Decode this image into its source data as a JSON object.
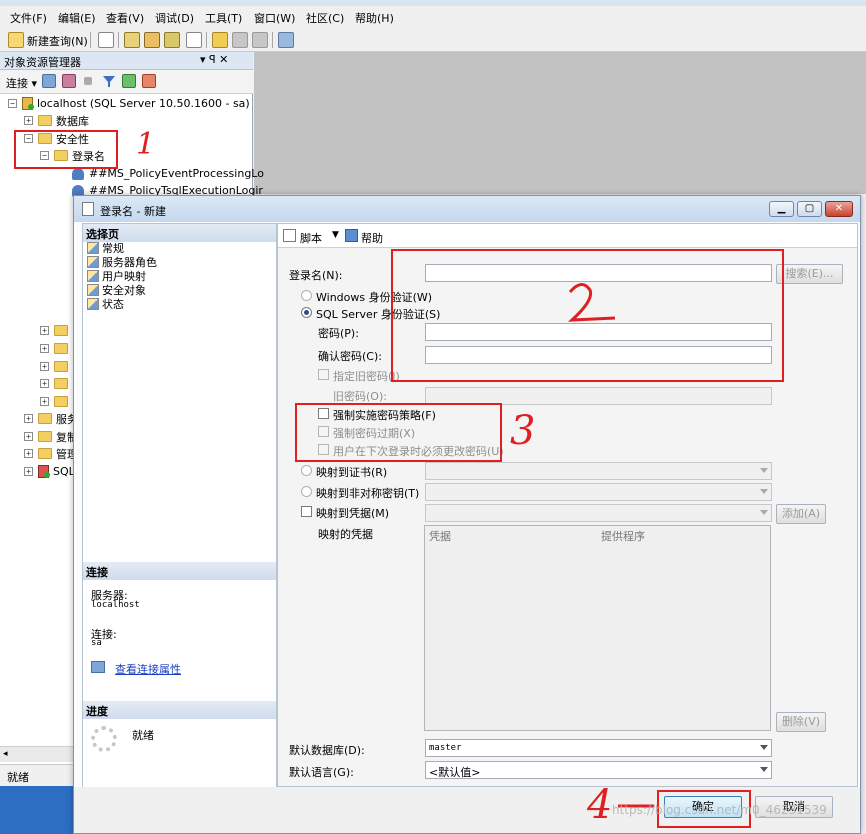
{
  "menubar": [
    "文件(F)",
    "编辑(E)",
    "查看(V)",
    "调试(D)",
    "工具(T)",
    "窗口(W)",
    "社区(C)",
    "帮助(H)"
  ],
  "toolbar": {
    "new_query": "新建查询(N)"
  },
  "object_explorer": {
    "title": "对象资源管理器",
    "pin": "▾ ꟼ ✕",
    "connect": "连接 ▾",
    "tree": {
      "server": "localhost (SQL Server 10.50.1600 - sa)",
      "databases": "数据库",
      "security": "安全性",
      "logins": "登录名",
      "login1": "##MS_PolicyEventProcessingLo",
      "login2": "##MS_PolicyTsqlExecutionLogir",
      "server_objects": "服务",
      "replication": "复制",
      "management": "管理",
      "sql_agent": "SQL"
    }
  },
  "statusbar": {
    "text": "就绪"
  },
  "dialog": {
    "title": "登录名 - 新建",
    "select_page": {
      "header": "选择页",
      "items": [
        "常规",
        "服务器角色",
        "用户映射",
        "安全对象",
        "状态"
      ]
    },
    "connection": {
      "header": "连接",
      "server_label": "服务器:",
      "server_value": "localhost",
      "conn_label": "连接:",
      "conn_value": "sa",
      "view_props": "查看连接属性"
    },
    "progress": {
      "header": "进度",
      "status": "就绪"
    },
    "toolbar": {
      "script": "脚本",
      "help": "帮助"
    },
    "form": {
      "login_name_label": "登录名(N):",
      "search_button": "搜索(E)...",
      "windows_auth": "Windows 身份验证(W)",
      "sql_auth": "SQL Server 身份验证(S)",
      "password_label": "密码(P):",
      "confirm_password_label": "确认密码(C):",
      "specify_old_password": "指定旧密码(I)",
      "old_password_label": "旧密码(O):",
      "enforce_policy": "强制实施密码策略(F)",
      "enforce_expiration": "强制密码过期(X)",
      "must_change": "用户在下次登录时必须更改密码(U)",
      "map_cert": "映射到证书(R)",
      "map_asym_key": "映射到非对称密钥(T)",
      "map_credential": "映射到凭据(M)",
      "add_button": "添加(A)",
      "mapped_credentials": "映射的凭据",
      "grid_columns": [
        "凭据",
        "提供程序"
      ],
      "remove_button": "删除(V)",
      "default_db_label": "默认数据库(D):",
      "default_db_value": "master",
      "default_lang_label": "默认语言(G):",
      "default_lang_value": "<默认值>"
    },
    "ok_button": "确定",
    "cancel_button": "取消"
  },
  "annotations": [
    "1",
    "2",
    "3",
    "4"
  ],
  "watermark": "https://blog.csdn.net/m0_46231539",
  "colors": {
    "annotation_red": "#e02020",
    "dialog_title": "#c5d8ee"
  }
}
